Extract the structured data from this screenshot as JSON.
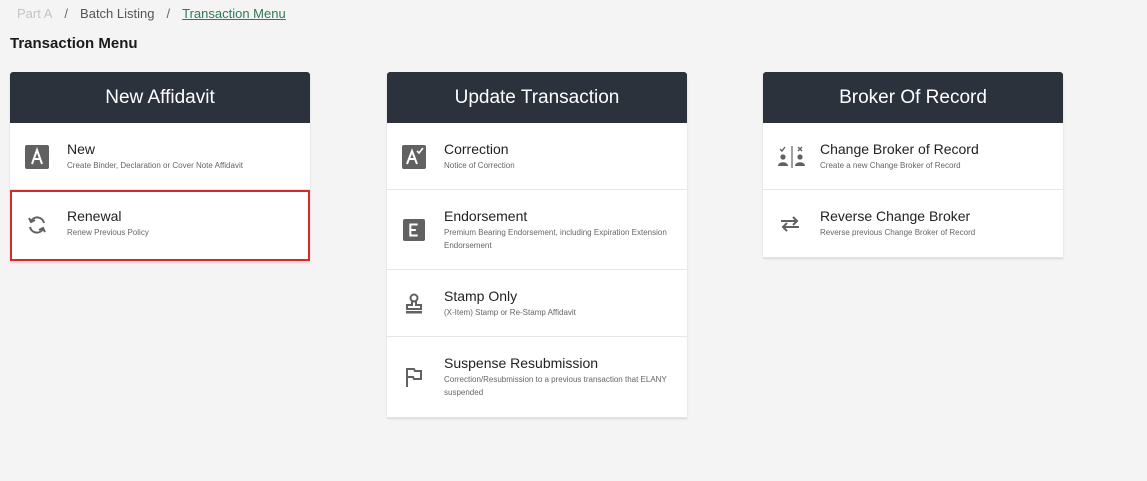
{
  "breadcrumb": {
    "items": [
      "Part A",
      "Batch Listing",
      "Transaction Menu"
    ],
    "separator": "/"
  },
  "page": {
    "title": "Transaction Menu"
  },
  "colors": {
    "header_bg": "#2b323c",
    "accent_link": "#2f7a56",
    "highlight_border": "#d32a2a"
  },
  "cards": [
    {
      "title": "New Affidavit",
      "items": [
        {
          "title": "New",
          "description": "Create Binder, Declaration or Cover Note Affidavit",
          "icon": "letter-a-box-icon"
        },
        {
          "title": "Renewal",
          "description": "Renew Previous Policy",
          "icon": "renew-icon"
        }
      ]
    },
    {
      "title": "Update Transaction",
      "items": [
        {
          "title": "Correction",
          "description": "Notice of Correction",
          "icon": "letter-a-check-icon"
        },
        {
          "title": "Endorsement",
          "description": "Premium Bearing Endorsement, including Expiration Extension Endorsement",
          "icon": "letter-e-box-icon"
        },
        {
          "title": "Stamp Only",
          "description": "(X-Item) Stamp or Re-Stamp Affidavit",
          "icon": "stamp-icon"
        },
        {
          "title": "Suspense Resubmission",
          "description": "Correction/Resubmission to a previous transaction that ELANY suspended",
          "icon": "flag-icon"
        }
      ]
    },
    {
      "title": "Broker Of Record",
      "items": [
        {
          "title": "Change Broker of Record",
          "description": "Create a new Change Broker of Record",
          "icon": "broker-change-icon"
        },
        {
          "title": "Reverse Change Broker",
          "description": "Reverse previous Change Broker of Record",
          "icon": "swap-arrows-icon"
        }
      ]
    }
  ]
}
